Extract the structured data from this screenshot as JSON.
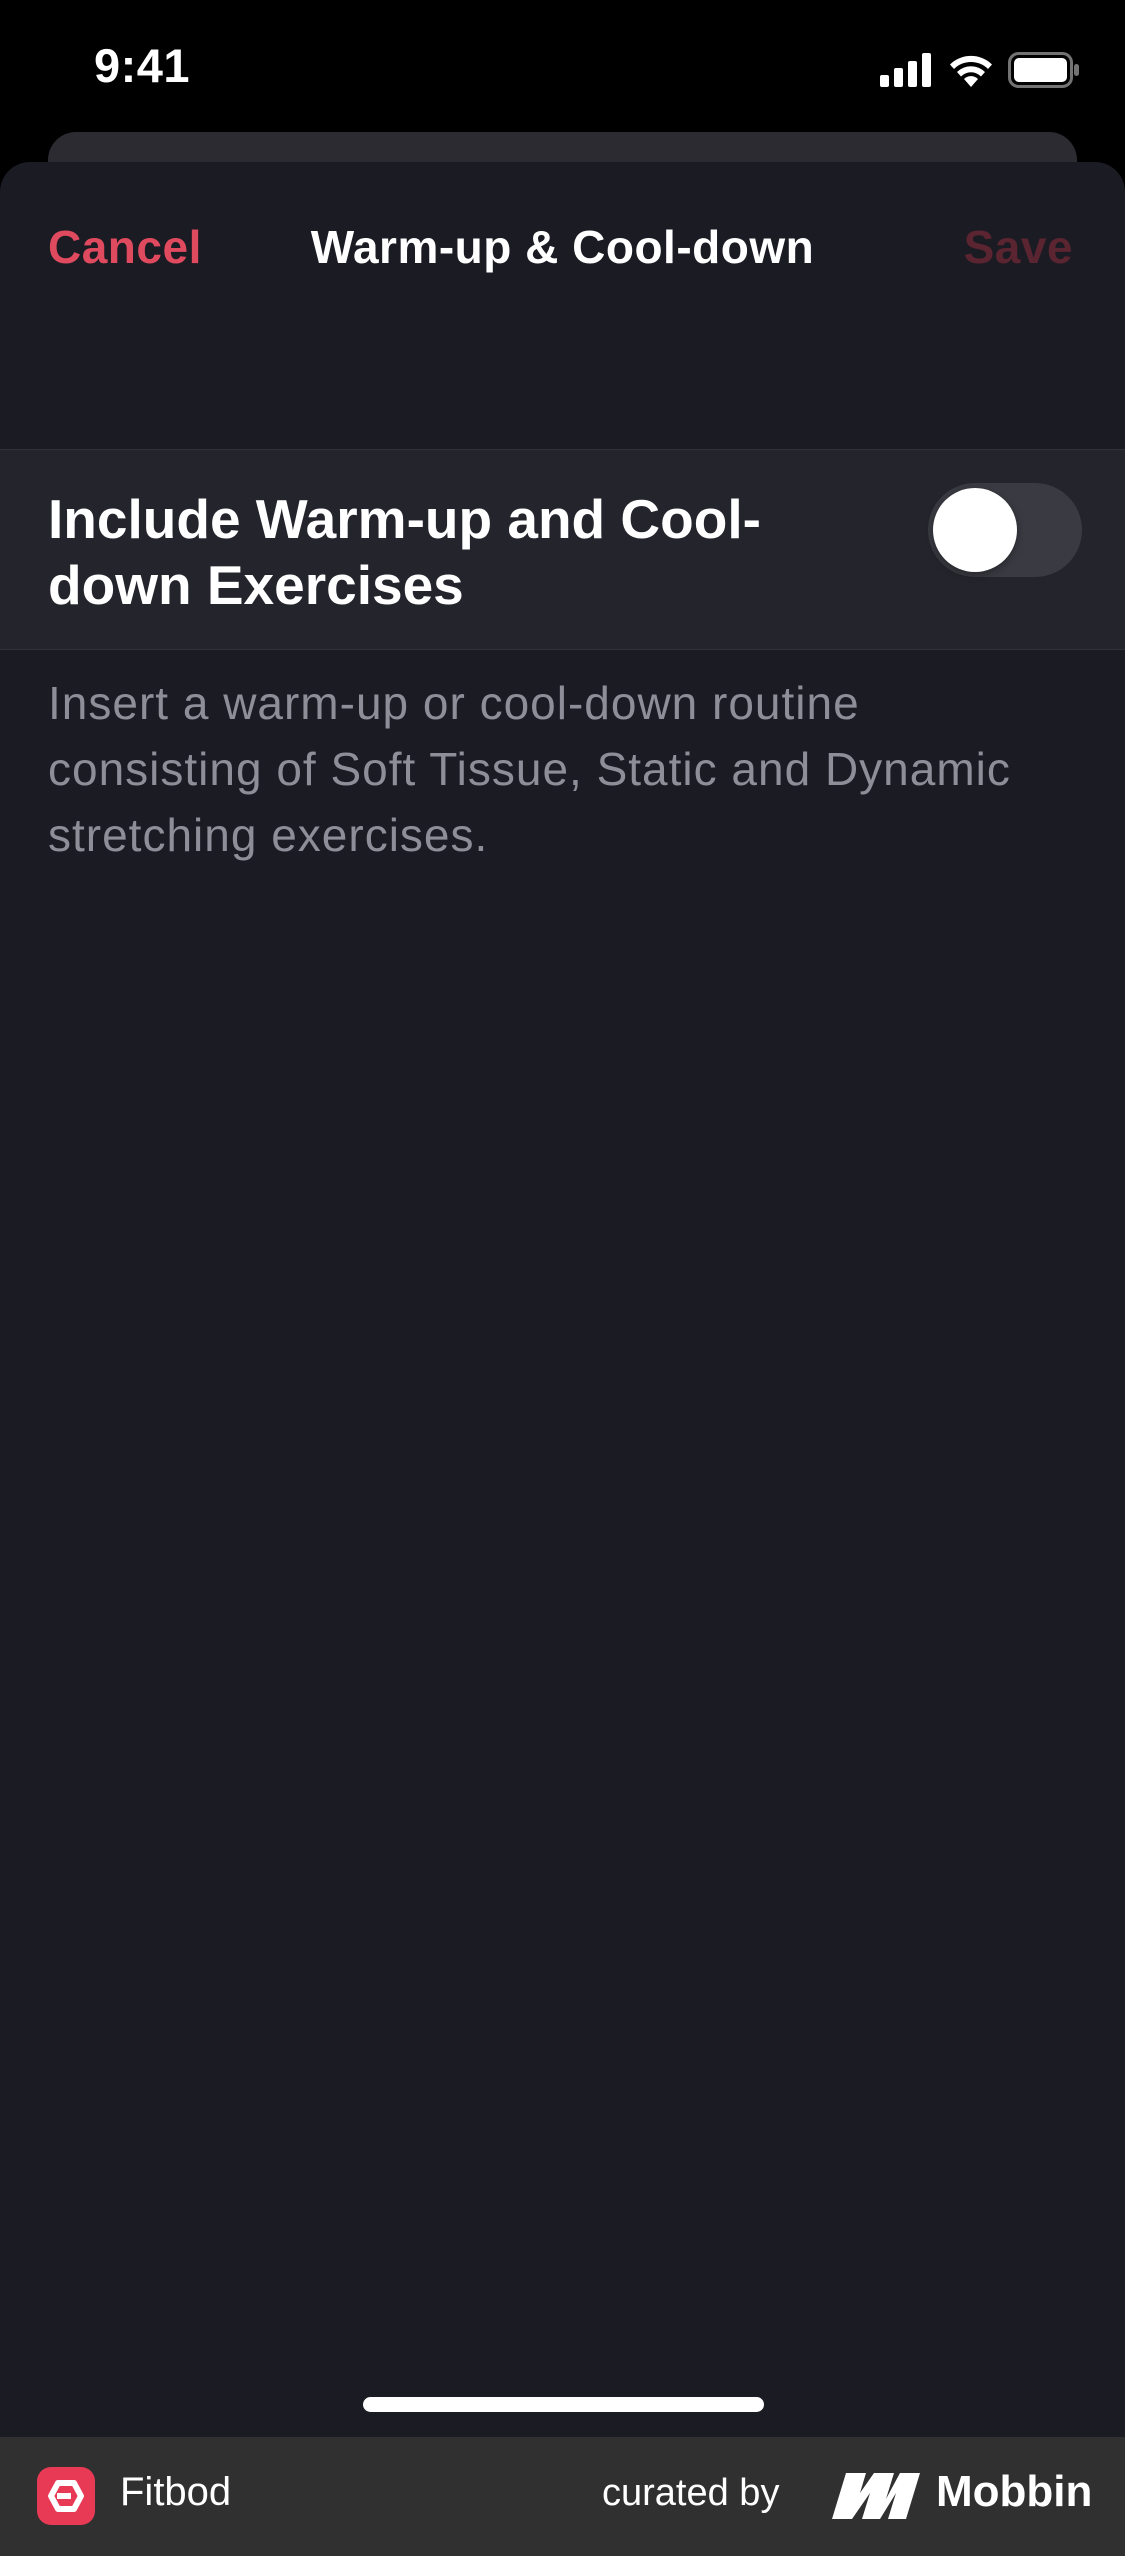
{
  "status_bar": {
    "time": "9:41"
  },
  "nav": {
    "cancel_label": "Cancel",
    "title": "Warm-up & Cool-down",
    "save_label": "Save"
  },
  "setting": {
    "label": "Include Warm-up and Cool-down Exercises",
    "toggle_on": false
  },
  "description": "Insert a warm-up or cool-down routine consisting of Soft Tissue, Static and Dynamic stretching exercises.",
  "footer": {
    "app_name": "Fitbod",
    "curated_by": "curated by",
    "brand": "Mobbin"
  },
  "colors": {
    "accent": "#e04a5f",
    "save_disabled": "#5a2430",
    "sheet_background": "#1b1b23",
    "row_background": "#24242c"
  },
  "icons": [
    "cellular-signal-icon",
    "wifi-icon",
    "battery-icon",
    "fitbod-logo-icon",
    "mobbin-logo-icon"
  ]
}
